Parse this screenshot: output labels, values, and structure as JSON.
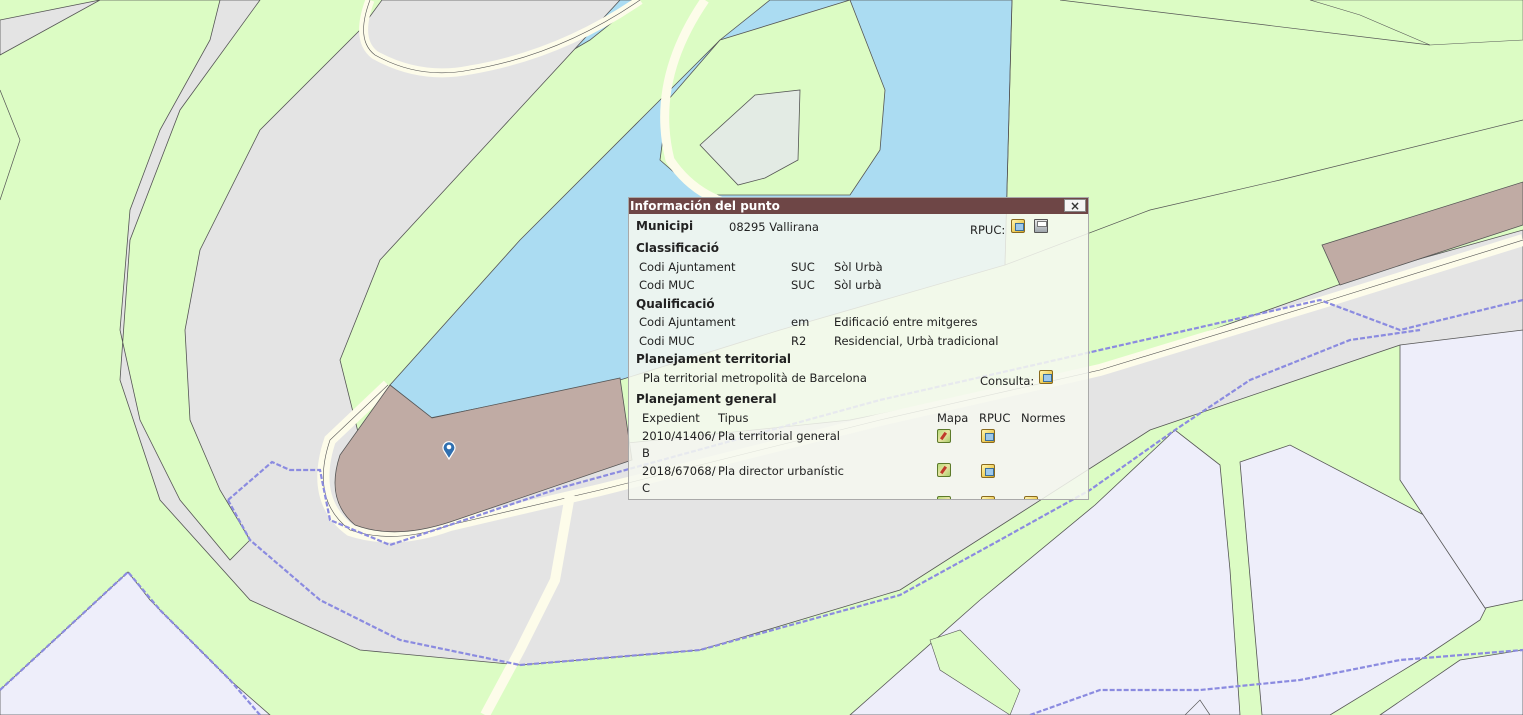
{
  "map": {
    "colors": {
      "residential_green": "#dcfcc4",
      "water": "#abdcf2",
      "road": "#e4e4e4",
      "road_edge": "#fdfcea",
      "urban_parcel": "#c0aba4",
      "building": "#e3ebe4",
      "lavender_zone": "#eeeefa",
      "boundary": "#8b8be0"
    },
    "marker_icon": "map-pin-icon"
  },
  "popup": {
    "title": "Información del punto",
    "close_label": "×",
    "municipi_label": "Municipi",
    "municipi_value": "08295 Vallirana",
    "rpuc_label": "RPUC:",
    "classificacio": {
      "title": "Classificació",
      "rows": [
        {
          "label": "Codi Ajuntament",
          "code": "SUC",
          "desc": "Sòl Urbà"
        },
        {
          "label": "Codi MUC",
          "code": "SUC",
          "desc": "Sòl urbà"
        }
      ]
    },
    "qualificacio": {
      "title": "Qualificació",
      "rows": [
        {
          "label": "Codi Ajuntament",
          "code": "em",
          "desc": "Edificació entre mitgeres"
        },
        {
          "label": "Codi MUC",
          "code": "R2",
          "desc": "Residencial, Urbà tradicional"
        }
      ]
    },
    "territorial": {
      "title": "Planejament territorial",
      "plan": "Pla territorial metropolità de Barcelona",
      "consulta_label": "Consulta:"
    },
    "general": {
      "title": "Planejament general",
      "headers": {
        "expedient": "Expedient",
        "tipus": "Tipus",
        "mapa": "Mapa",
        "rpuc": "RPUC",
        "normes": "Normes"
      },
      "rows": [
        {
          "expedient": "2010/41406/",
          "suffix": "B",
          "tipus": "Pla territorial general"
        },
        {
          "expedient": "2018/67068/",
          "suffix": "C",
          "tipus": "Pla director urbanístic"
        }
      ]
    }
  }
}
